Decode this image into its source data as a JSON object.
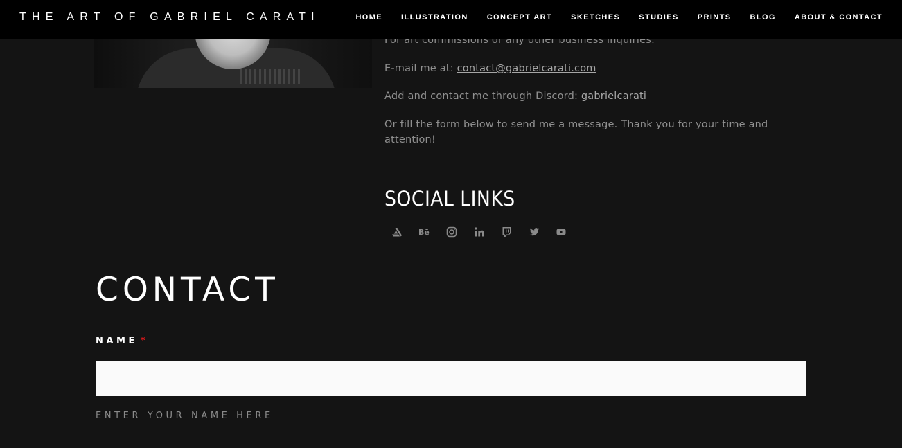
{
  "header": {
    "site_title": "THE ART OF GABRIEL CARATI",
    "nav": [
      "HOME",
      "ILLUSTRATION",
      "CONCEPT ART",
      "SKETCHES",
      "STUDIES",
      "PRINTS",
      "BLOG",
      "ABOUT & CONTACT"
    ]
  },
  "about": {
    "commissions_text": "For art commissions or any other business inquiries:",
    "email_prefix": "E-mail me at: ",
    "email": "contact@gabrielcarati.com",
    "discord_prefix": "Add and contact me through Discord: ",
    "discord": "gabrielcarati",
    "form_text": "Or fill the form below to send me a message. Thank you for your time and attention!"
  },
  "social": {
    "title": "SOCIAL LINKS",
    "icons": [
      "artstation-icon",
      "behance-icon",
      "instagram-icon",
      "linkedin-icon",
      "twitch-icon",
      "twitter-icon",
      "youtube-icon"
    ]
  },
  "contact": {
    "heading": "CONTACT",
    "name_label": "NAME",
    "required_mark": "*",
    "name_value": "",
    "name_hint": "ENTER YOUR NAME HERE"
  },
  "colors": {
    "background": "#141414",
    "header": "#000000",
    "required": "#e0191c"
  }
}
